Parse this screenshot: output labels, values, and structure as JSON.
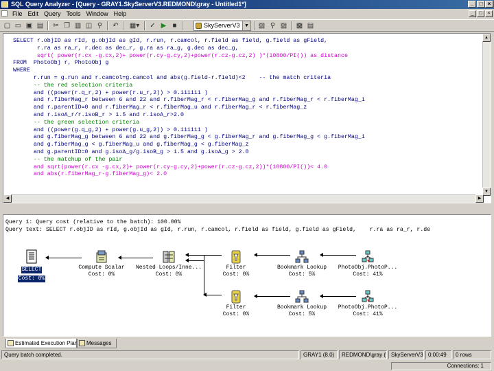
{
  "window": {
    "title": "SQL Query Analyzer - [Query - GRAY1.SkyServerV3.REDMOND\\gray - Untitled1*]",
    "minimize": "_",
    "maximize": "□",
    "close": "×"
  },
  "menu": {
    "items": [
      "File",
      "Edit",
      "Query",
      "Tools",
      "Window",
      "Help"
    ],
    "child_minimize": "_",
    "child_restore": "□",
    "child_close": "×"
  },
  "toolbar": {
    "database": "SkyServerV3"
  },
  "editor": {
    "lines": [
      {
        "text": "SELECT r.objID as rId, g.objId as gId, r.run, r.camcol, r.field as field, g.field as gField,",
        "kind": "code"
      },
      {
        "text": "       r.ra as ra_r, r.dec as dec_r, g.ra as ra_g, g.dec as dec_g,",
        "kind": "code"
      },
      {
        "text": "       sqrt( power(r.cx -g.cx,2)+ power(r.cy-g.cy,2)+power(r.cz-g.cz,2) )*(10800/PI()) as distance",
        "kind": "fn"
      },
      {
        "text": "FROM  PhotoObj r, PhotoObj g",
        "kind": "code"
      },
      {
        "text": "WHERE",
        "kind": "code"
      },
      {
        "text": "      r.run = g.run and r.camcol=g.camcol and abs(g.field-r.field)<2    -- the match criteria",
        "kind": "code"
      },
      {
        "text": "      -- the red selection criteria",
        "kind": "comment"
      },
      {
        "text": "      and ((power(r.q_r,2) + power(r.u_r,2)) > 0.111111 )",
        "kind": "code"
      },
      {
        "text": "      and r.fiberMag_r between 6 and 22 and r.fiberMag_r < r.fiberMag_g and r.fiberMag_r < r.fiberMag_i",
        "kind": "code"
      },
      {
        "text": "      and r.parentID=0 and r.fiberMag_r < r.fiberMag_u and r.fiberMag_r < r.fiberMag_z",
        "kind": "code"
      },
      {
        "text": "      and r.isoA_r/r.isoB_r > 1.5 and r.isoA_r>2.0",
        "kind": "code"
      },
      {
        "text": "      -- the green selection criteria",
        "kind": "comment"
      },
      {
        "text": "      and ((power(g.q_g,2) + power(g.u_g,2)) > 0.111111 )",
        "kind": "code"
      },
      {
        "text": "      and g.fiberMag_g between 6 and 22 and g.fiberMag_g < g.fiberMag_r and g.fiberMag_g < g.fiberMag_i",
        "kind": "code"
      },
      {
        "text": "      and g.fiberMag_g < g.fiberMag_u and g.fiberMag_g < g.fiberMag_z",
        "kind": "code"
      },
      {
        "text": "      and g.parentID=0 and g.isoA_g/g.isoB_g > 1.5 and g.isoA_g > 2.0",
        "kind": "code"
      },
      {
        "text": "      -- the matchup of the pair",
        "kind": "comment"
      },
      {
        "text": "      and sqrt(power(r.cx -g.cx,2)+ power(r.cy-g.cy,2)+power(r.cz-g.cz,2))*(10800/PI())< 4.0",
        "kind": "fn"
      },
      {
        "text": "      and abs(r.fiberMag_r-g.fiberMag_g)< 2.0",
        "kind": "fn"
      }
    ]
  },
  "results": {
    "query_header": "Query 1: Query cost (relative to the batch): 100.00%",
    "query_text": "Query text: SELECT r.objID as rId, g.objId as gId, r.run, r.camcol, r.field as field, g.field as gField,    r.ra as ra_r, r.de",
    "nodes": [
      {
        "label": "SELECT",
        "cost": "Cost: 0%",
        "icon": "select-icon"
      },
      {
        "label": "Compute Scalar",
        "cost": "Cost: 0%",
        "icon": "compute-scalar-icon"
      },
      {
        "label": "Nested Loops/Inne...",
        "cost": "Cost: 0%",
        "icon": "nested-loops-icon"
      },
      {
        "label": "Filter",
        "cost": "Cost: 0%",
        "icon": "filter-icon"
      },
      {
        "label": "Bookmark Lookup",
        "cost": "Cost: 5%",
        "icon": "bookmark-lookup-icon"
      },
      {
        "label": "PhotoObj.PhotoP...",
        "cost": "Cost: 41%",
        "icon": "index-seek-icon"
      },
      {
        "label": "Filter",
        "cost": "Cost: 0%",
        "icon": "filter-icon"
      },
      {
        "label": "Bookmark Lookup",
        "cost": "Cost: 5%",
        "icon": "bookmark-lookup-icon"
      },
      {
        "label": "PhotoObj.PhotoP...",
        "cost": "Cost: 41%",
        "icon": "index-seek-icon"
      }
    ]
  },
  "tabs": [
    {
      "label": "Estimated Execution Plan",
      "active": true
    },
    {
      "label": "Messages",
      "active": false
    }
  ],
  "status": {
    "message": "Query batch completed.",
    "server": "GRAY1 (8.0)",
    "user": "REDMOND\\gray (51)",
    "database": "SkyServerV3",
    "elapsed": "0:00:49",
    "rows": "0 rows",
    "connections": "Connections: 1"
  },
  "colors": {
    "keyword": "#000080",
    "comment": "#008000",
    "function": "#cc00cc",
    "selection": "#0a246a",
    "titlebar": "#0a246a"
  }
}
